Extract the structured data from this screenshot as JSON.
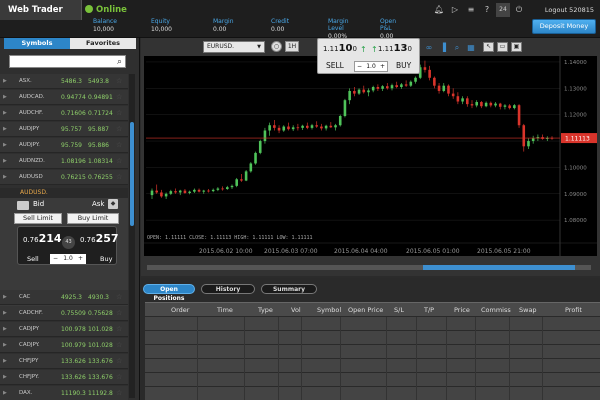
{
  "topbar": {
    "app_title": "Web Trader",
    "status": "Online",
    "stats": [
      {
        "label": "Balance",
        "value": "10,000"
      },
      {
        "label": "Equity",
        "value": "10,000"
      },
      {
        "label": "Margin",
        "value": "0.00"
      },
      {
        "label": "Credit",
        "value": "0.00"
      },
      {
        "label": "Margin Level",
        "value": "0.00%"
      },
      {
        "label": "Open P&L",
        "value": "0.00"
      }
    ],
    "notification_count": "24",
    "logout_label": "Logout 520815",
    "deposit_label": "Deposit Money"
  },
  "left": {
    "tabs": [
      "Symbols",
      "Favorites"
    ],
    "search": {
      "placeholder": "",
      "value": ""
    },
    "symbols_top": [
      {
        "name": "ASX.",
        "bid": "5486.3",
        "ask": "5493.8"
      },
      {
        "name": "AUDCAD.",
        "bid": "0.94774",
        "ask": "0.94891"
      },
      {
        "name": "AUDCHF.",
        "bid": "0.71606",
        "ask": "0.71724"
      },
      {
        "name": "AUDJPY",
        "bid": "95.757",
        "ask": "95.887"
      },
      {
        "name": "AUDJPY.",
        "bid": "95.759",
        "ask": "95.886"
      },
      {
        "name": "AUDNZD.",
        "bid": "1.08196",
        "ask": "1.08314"
      },
      {
        "name": "AUDUSD",
        "bid": "0.76215",
        "ask": "0.76255"
      }
    ],
    "trade": {
      "symbol": "AUDUSD.",
      "bid_label": "Bid",
      "ask_label": "Ask",
      "sell_limit": "Sell Limit",
      "buy_limit": "Buy Limit",
      "bid_small": "0.76",
      "bid_big": "214",
      "ask_small": "0.76",
      "ask_big": "257",
      "spread": "43",
      "sell": "Sell",
      "buy": "Buy",
      "quantity": "1.0",
      "minus": "−",
      "plus": "+"
    },
    "symbols_bottom": [
      {
        "name": "CAC",
        "bid": "4925.3",
        "ask": "4930.3"
      },
      {
        "name": "CADCHF.",
        "bid": "0.75509",
        "ask": "0.75628"
      },
      {
        "name": "CADJPY",
        "bid": "100.978",
        "ask": "101.028"
      },
      {
        "name": "CADJPY.",
        "bid": "100.979",
        "ask": "101.028"
      },
      {
        "name": "CHFJPY",
        "bid": "133.626",
        "ask": "133.676"
      },
      {
        "name": "CHFJPY.",
        "bid": "133.626",
        "ask": "133.676"
      },
      {
        "name": "DAX.",
        "bid": "11190.3",
        "ask": "11192.8"
      }
    ]
  },
  "chart_panel": {
    "symbol": "EURUSD.",
    "timeframe": "1H",
    "sell_price_small": "1.11",
    "sell_price_big": "10",
    "sell_price_sup": "0",
    "buy_price_small": "1.11",
    "buy_price_big": "13",
    "buy_price_sup": "0",
    "sell_label": "SELL",
    "buy_label": "BUY",
    "quantity": "1.0",
    "minus": "−",
    "plus": "+",
    "ohlc_readout": "OPEN: 1.11111  CLOSE: 1.11113  HIGH: 1.11111  LOW: 1.11111",
    "current_price_label": "1.11113"
  },
  "chart_data": {
    "type": "candlestick",
    "y_ticks": [
      "1.14000",
      "1.13000",
      "1.12000",
      "1.11000",
      "1.10000",
      "1.09000",
      "1.08000"
    ],
    "x_ticks": [
      "2015.06.02 10:00",
      "2015.06.03 07:00",
      "2015.06.04 04:00",
      "2015.06.05 01:00",
      "2015.06.05 21:00"
    ],
    "ylim": [
      1.0755,
      1.1415
    ],
    "current_price": 1.11113,
    "candles": [
      [
        1.0895,
        1.092,
        1.088,
        1.0912
      ],
      [
        1.0912,
        1.0935,
        1.09,
        1.0905
      ],
      [
        1.0905,
        1.0915,
        1.0885,
        1.089
      ],
      [
        1.089,
        1.0905,
        1.088,
        1.09
      ],
      [
        1.09,
        1.0915,
        1.0895,
        1.091
      ],
      [
        1.091,
        1.092,
        1.09,
        1.0905
      ],
      [
        1.0905,
        1.0915,
        1.0895,
        1.0912
      ],
      [
        1.0912,
        1.0918,
        1.09,
        1.0903
      ],
      [
        1.0903,
        1.0912,
        1.0898,
        1.0908
      ],
      [
        1.0908,
        1.092,
        1.0903,
        1.0915
      ],
      [
        1.0915,
        1.092,
        1.0905,
        1.0908
      ],
      [
        1.0908,
        1.0915,
        1.09,
        1.0912
      ],
      [
        1.0912,
        1.0918,
        1.0905,
        1.091
      ],
      [
        1.091,
        1.092,
        1.0906,
        1.0915
      ],
      [
        1.0915,
        1.0925,
        1.091,
        1.092
      ],
      [
        1.092,
        1.0928,
        1.0912,
        1.0918
      ],
      [
        1.0918,
        1.093,
        1.0915,
        1.0925
      ],
      [
        1.0925,
        1.0935,
        1.0918,
        1.093
      ],
      [
        1.093,
        1.096,
        1.0925,
        1.0955
      ],
      [
        1.0955,
        1.0975,
        1.0945,
        1.095
      ],
      [
        1.095,
        1.099,
        1.0948,
        1.0985
      ],
      [
        1.0985,
        1.102,
        1.098,
        1.1015
      ],
      [
        1.1015,
        1.106,
        1.101,
        1.1055
      ],
      [
        1.1055,
        1.1105,
        1.105,
        1.11
      ],
      [
        1.11,
        1.115,
        1.109,
        1.114
      ],
      [
        1.114,
        1.117,
        1.112,
        1.116
      ],
      [
        1.116,
        1.118,
        1.114,
        1.115
      ],
      [
        1.115,
        1.116,
        1.113,
        1.114
      ],
      [
        1.114,
        1.116,
        1.1135,
        1.1155
      ],
      [
        1.1155,
        1.117,
        1.114,
        1.1145
      ],
      [
        1.1145,
        1.116,
        1.1138,
        1.1152
      ],
      [
        1.1152,
        1.1165,
        1.114,
        1.115
      ],
      [
        1.115,
        1.1162,
        1.1142,
        1.1158
      ],
      [
        1.1158,
        1.117,
        1.1145,
        1.115
      ],
      [
        1.115,
        1.1165,
        1.1144,
        1.116
      ],
      [
        1.116,
        1.1175,
        1.115,
        1.1155
      ],
      [
        1.1155,
        1.1165,
        1.114,
        1.1148
      ],
      [
        1.1148,
        1.1162,
        1.114,
        1.1158
      ],
      [
        1.1158,
        1.1172,
        1.115,
        1.1152
      ],
      [
        1.1152,
        1.1165,
        1.114,
        1.116
      ],
      [
        1.116,
        1.12,
        1.1155,
        1.1195
      ],
      [
        1.1195,
        1.126,
        1.119,
        1.1255
      ],
      [
        1.1255,
        1.13,
        1.124,
        1.129
      ],
      [
        1.129,
        1.1305,
        1.127,
        1.128
      ],
      [
        1.128,
        1.13,
        1.1275,
        1.1295
      ],
      [
        1.1295,
        1.131,
        1.128,
        1.1285
      ],
      [
        1.1285,
        1.13,
        1.127,
        1.1292
      ],
      [
        1.1292,
        1.131,
        1.1285,
        1.1305
      ],
      [
        1.1305,
        1.1315,
        1.129,
        1.1298
      ],
      [
        1.1298,
        1.1312,
        1.129,
        1.1308
      ],
      [
        1.1308,
        1.132,
        1.1295,
        1.13
      ],
      [
        1.13,
        1.1318,
        1.1292,
        1.1312
      ],
      [
        1.1312,
        1.1325,
        1.13,
        1.1305
      ],
      [
        1.1305,
        1.132,
        1.1298,
        1.1315
      ],
      [
        1.1315,
        1.133,
        1.1305,
        1.131
      ],
      [
        1.131,
        1.133,
        1.1305,
        1.1325
      ],
      [
        1.1325,
        1.1345,
        1.1318,
        1.134
      ],
      [
        1.134,
        1.139,
        1.1335,
        1.138
      ],
      [
        1.138,
        1.1405,
        1.136,
        1.137
      ],
      [
        1.137,
        1.1385,
        1.133,
        1.134
      ],
      [
        1.134,
        1.1345,
        1.13,
        1.131
      ],
      [
        1.131,
        1.132,
        1.128,
        1.129
      ],
      [
        1.129,
        1.132,
        1.1285,
        1.131
      ],
      [
        1.131,
        1.1315,
        1.127,
        1.128
      ],
      [
        1.128,
        1.13,
        1.126,
        1.127
      ],
      [
        1.127,
        1.1285,
        1.124,
        1.125
      ],
      [
        1.125,
        1.127,
        1.124,
        1.1262
      ],
      [
        1.1262,
        1.127,
        1.123,
        1.124
      ],
      [
        1.124,
        1.1255,
        1.1225,
        1.1235
      ],
      [
        1.1235,
        1.1255,
        1.1228,
        1.1248
      ],
      [
        1.1248,
        1.1252,
        1.1225,
        1.1232
      ],
      [
        1.1232,
        1.125,
        1.1228,
        1.1245
      ],
      [
        1.1245,
        1.125,
        1.1228,
        1.1235
      ],
      [
        1.1235,
        1.1248,
        1.1228,
        1.1242
      ],
      [
        1.1242,
        1.1245,
        1.122,
        1.123
      ],
      [
        1.123,
        1.124,
        1.122,
        1.1235
      ],
      [
        1.1235,
        1.124,
        1.122,
        1.1225
      ],
      [
        1.1225,
        1.124,
        1.122,
        1.1236
      ],
      [
        1.1236,
        1.124,
        1.115,
        1.116
      ],
      [
        1.116,
        1.1165,
        1.106,
        1.108
      ],
      [
        1.108,
        1.111,
        1.107,
        1.11
      ],
      [
        1.11,
        1.112,
        1.109,
        1.111
      ],
      [
        1.111,
        1.1125,
        1.11,
        1.1115
      ],
      [
        1.1115,
        1.1125,
        1.1105,
        1.1108
      ],
      [
        1.1108,
        1.1118,
        1.11,
        1.1112
      ],
      [
        1.1112,
        1.1118,
        1.1105,
        1.1111
      ]
    ]
  },
  "bottom": {
    "tabs": [
      "Open Positions",
      "History",
      "Summary"
    ],
    "columns": [
      "Order",
      "Time",
      "Type",
      "Vol",
      "Symbol",
      "Open Price",
      "S/L",
      "T/P",
      "Price",
      "Commiss",
      "Swap",
      "Profit"
    ]
  },
  "colors": {
    "accent": "#2d86c8",
    "up": "#4fc35a",
    "down": "#d9342b",
    "online": "#79c13a"
  }
}
